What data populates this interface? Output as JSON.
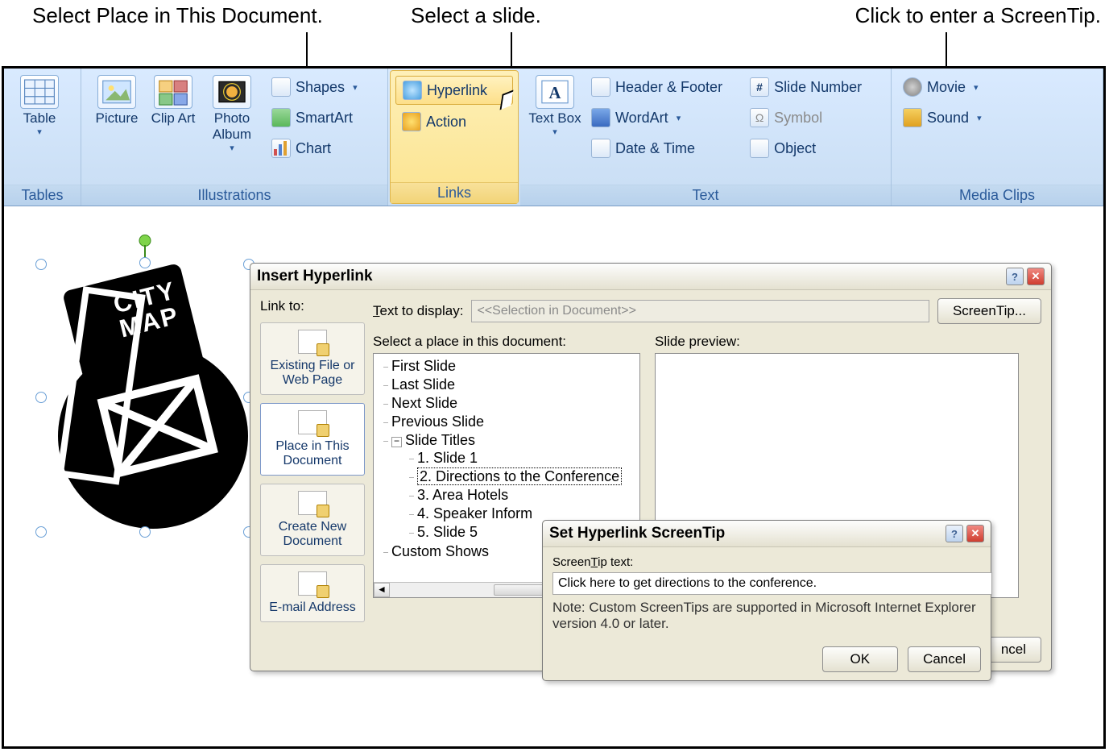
{
  "callouts": {
    "left": "Select Place in This Document.",
    "mid": "Select a slide.",
    "right": "Click to enter a ScreenTip."
  },
  "ribbon": {
    "tables": {
      "label": "Tables",
      "table": "Table"
    },
    "illustrations": {
      "label": "Illustrations",
      "picture": "Picture",
      "clipart": "Clip Art",
      "photoalbum": "Photo Album",
      "shapes": "Shapes",
      "smartart": "SmartArt",
      "chart": "Chart"
    },
    "links": {
      "label": "Links",
      "hyperlink": "Hyperlink",
      "action": "Action"
    },
    "text": {
      "label": "Text",
      "textbox": "Text Box",
      "headerfooter": "Header & Footer",
      "wordart": "WordArt",
      "datetime": "Date & Time",
      "slidenumber": "Slide Number",
      "symbol": "Symbol",
      "object": "Object"
    },
    "media": {
      "label": "Media Clips",
      "movie": "Movie",
      "sound": "Sound"
    }
  },
  "canvas": {
    "citymap_line1": "CITY",
    "citymap_line2": "MAP"
  },
  "dialog": {
    "title": "Insert Hyperlink",
    "link_to": "Link to:",
    "text_to_display": "Text to display:",
    "text_value": "<<Selection in Document>>",
    "screentip": "ScreenTip...",
    "linkto_items": {
      "existing": "Existing File or Web Page",
      "place": "Place in This Document",
      "createnew": "Create New Document",
      "email": "E-mail Address"
    },
    "select_place": "Select a place in this document:",
    "slide_preview": "Slide preview:",
    "tree": {
      "first": "First Slide",
      "last": "Last Slide",
      "next": "Next Slide",
      "prev": "Previous Slide",
      "titles": "Slide Titles",
      "s1": "1. Slide 1",
      "s2": "2. Directions to the Conference",
      "s3": "3. Area Hotels",
      "s4": "4. Speaker Inform",
      "s5": "5. Slide 5",
      "custom": "Custom Shows"
    },
    "ok": "OK",
    "cancel": "Cancel",
    "cancel_bg": "ncel"
  },
  "subdialog": {
    "title": "Set Hyperlink ScreenTip",
    "label": "ScreenTip text:",
    "value": "Click here to get directions to the conference.",
    "note": "Note: Custom ScreenTips are supported in Microsoft Internet Explorer version 4.0 or later.",
    "ok": "OK",
    "cancel": "Cancel"
  }
}
